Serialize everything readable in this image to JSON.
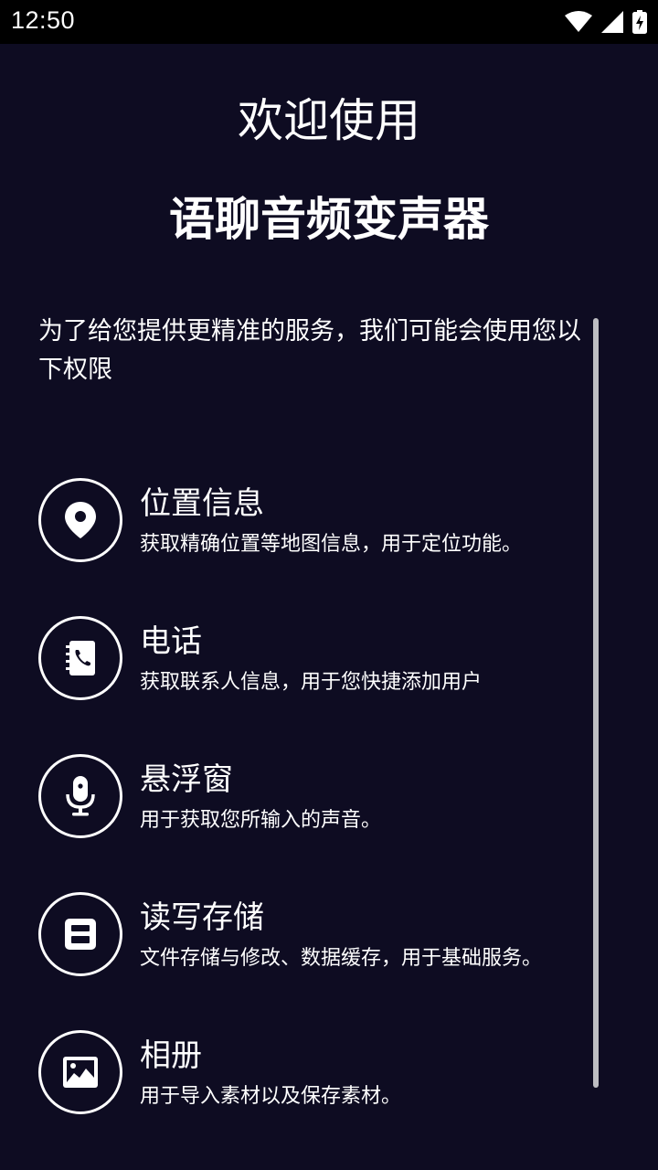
{
  "status_bar": {
    "time": "12:50",
    "icons": [
      "wifi-icon",
      "signal-icon",
      "battery-charging-icon"
    ]
  },
  "header": {
    "welcome": "欢迎使用",
    "app_name": "语聊音频变声器"
  },
  "intro": "为了给您提供更精准的服务，我们可能会使用您以下权限",
  "permissions": [
    {
      "icon": "location-pin-icon",
      "title": "位置信息",
      "desc": "获取精确位置等地图信息，用于定位功能。"
    },
    {
      "icon": "contacts-phone-icon",
      "title": "电话",
      "desc": "获取联系人信息，用于您快捷添加用户"
    },
    {
      "icon": "microphone-icon",
      "title": "悬浮窗",
      "desc": "用于获取您所输入的声音。"
    },
    {
      "icon": "save-disk-icon",
      "title": "读写存储",
      "desc": "文件存储与修改、数据缓存，用于基础服务。"
    },
    {
      "icon": "image-icon",
      "title": "相册",
      "desc": "用于导入素材以及保存素材。"
    }
  ],
  "colors": {
    "background": "#0e0c22",
    "status_bar": "#000000",
    "text": "#ffffff",
    "scrollbar": "#bdbdc2"
  }
}
